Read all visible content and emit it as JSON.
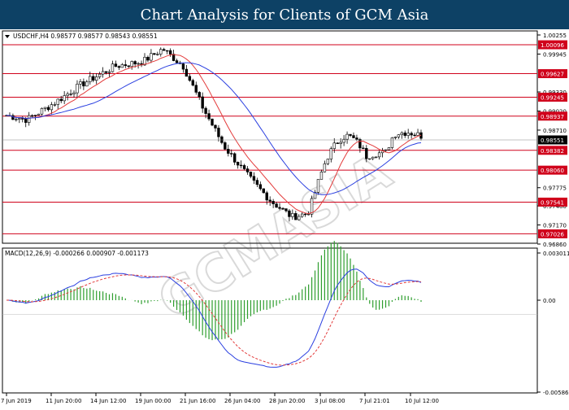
{
  "title": "Chart Analysis for Clients of GCM Asia",
  "colors": {
    "title_bg": "#0d4165",
    "level_line": "#d0021b",
    "level_label_bg": "#d0021b",
    "current_price_bg": "#000000",
    "fast_ma": "#e33b3b",
    "slow_ma": "#2a3fe0",
    "macd_line": "#2a3fe0",
    "signal_line": "#e33b3b",
    "histogram": "#2e9e2e",
    "candle_up": "#ffffff",
    "candle_down": "#000000"
  },
  "main_chart": {
    "symbol_info": "USDCHF,H4  0.98577 0.98577 0.98543 0.98551",
    "menu_icon": "triangle-down-icon",
    "y_ticks": [
      "1.00255",
      "0.99945",
      "0.99330",
      "0.99020",
      "0.98710",
      "0.97775",
      "0.97480",
      "0.97170",
      "0.96860"
    ],
    "levels": [
      "1.00096",
      "0.99627",
      "0.99245",
      "0.98937",
      "0.98382",
      "0.98060",
      "0.97541",
      "0.97026"
    ],
    "current_price": "0.98551",
    "watermark": "GCMASIA"
  },
  "indicator": {
    "label": "MACD(12,26,9) -0.000266 0.000907 -0.001173",
    "y_ticks": [
      "0.003011",
      "0.00",
      "-0.005863"
    ]
  },
  "x_axis_labels": [
    "7 Jun 2019",
    "11 Jun 20:00",
    "14 Jun 12:00",
    "19 Jun 00:00",
    "21 Jun 16:00",
    "26 Jun 04:00",
    "28 Jun 20:00",
    "3 Jul 08:00",
    "7 Jul 21:01",
    "10 Jul 12:00"
  ]
}
